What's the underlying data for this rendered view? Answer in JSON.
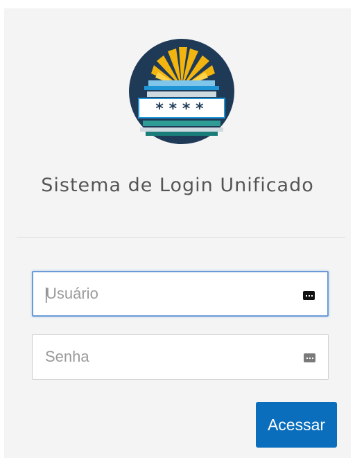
{
  "app": {
    "title": "Sistema de Login Unificado"
  },
  "logo": {
    "icon": "login-logo-icon",
    "mask_text": "****",
    "colors": {
      "circle": "#1e3a56",
      "rays": "#f2b40f",
      "book_blue": "#1f95d6",
      "band_white": "#ffffff",
      "band_teal": "#2f9c96"
    }
  },
  "form": {
    "username": {
      "placeholder": "Usuário",
      "value": "",
      "icon": "password-manager-key-icon",
      "focused": true
    },
    "password": {
      "placeholder": "Senha",
      "value": "",
      "icon": "password-manager-key-icon"
    },
    "submit_label": "Acessar"
  },
  "colors": {
    "panel_bg": "#f4f4f4",
    "accent": "#0a6ebd",
    "focus_border": "#6b9bd8",
    "title_text": "#555555"
  }
}
